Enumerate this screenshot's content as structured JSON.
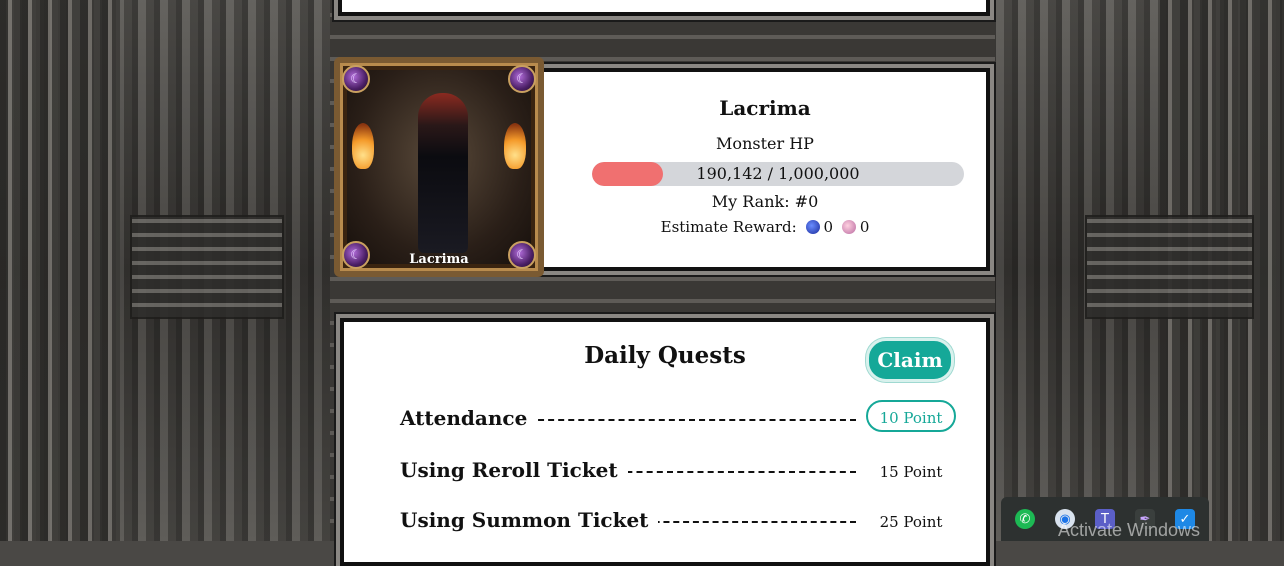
{
  "boss": {
    "card_name": "Lacrima",
    "name": "Lacrima",
    "hp_label": "Monster HP",
    "hp_current": 190142,
    "hp_max": 1000000,
    "hp_text": "190,142 / 1,000,000",
    "hp_fraction": 0.19,
    "rank_text": "My Rank: #0",
    "reward_label": "Estimate Reward:",
    "reward_values": [
      "0",
      "0"
    ],
    "colors": {
      "hp_fill": "#f07070",
      "hp_track": "#d4d6da"
    }
  },
  "quests": {
    "title": "Daily Quests",
    "claim_label": "Claim",
    "accent": "#15a898",
    "items": [
      {
        "name": "Attendance",
        "points": "10 Point",
        "active": true
      },
      {
        "name": "Using Reroll Ticket",
        "points": "15 Point",
        "active": false
      },
      {
        "name": "Using Summon Ticket",
        "points": "25 Point",
        "active": false
      }
    ]
  },
  "taskbar": {
    "icons": [
      "whatsapp-icon",
      "browser-icon",
      "teams-icon",
      "feather-icon",
      "shield-icon"
    ],
    "watermark": "Activate Windows"
  }
}
